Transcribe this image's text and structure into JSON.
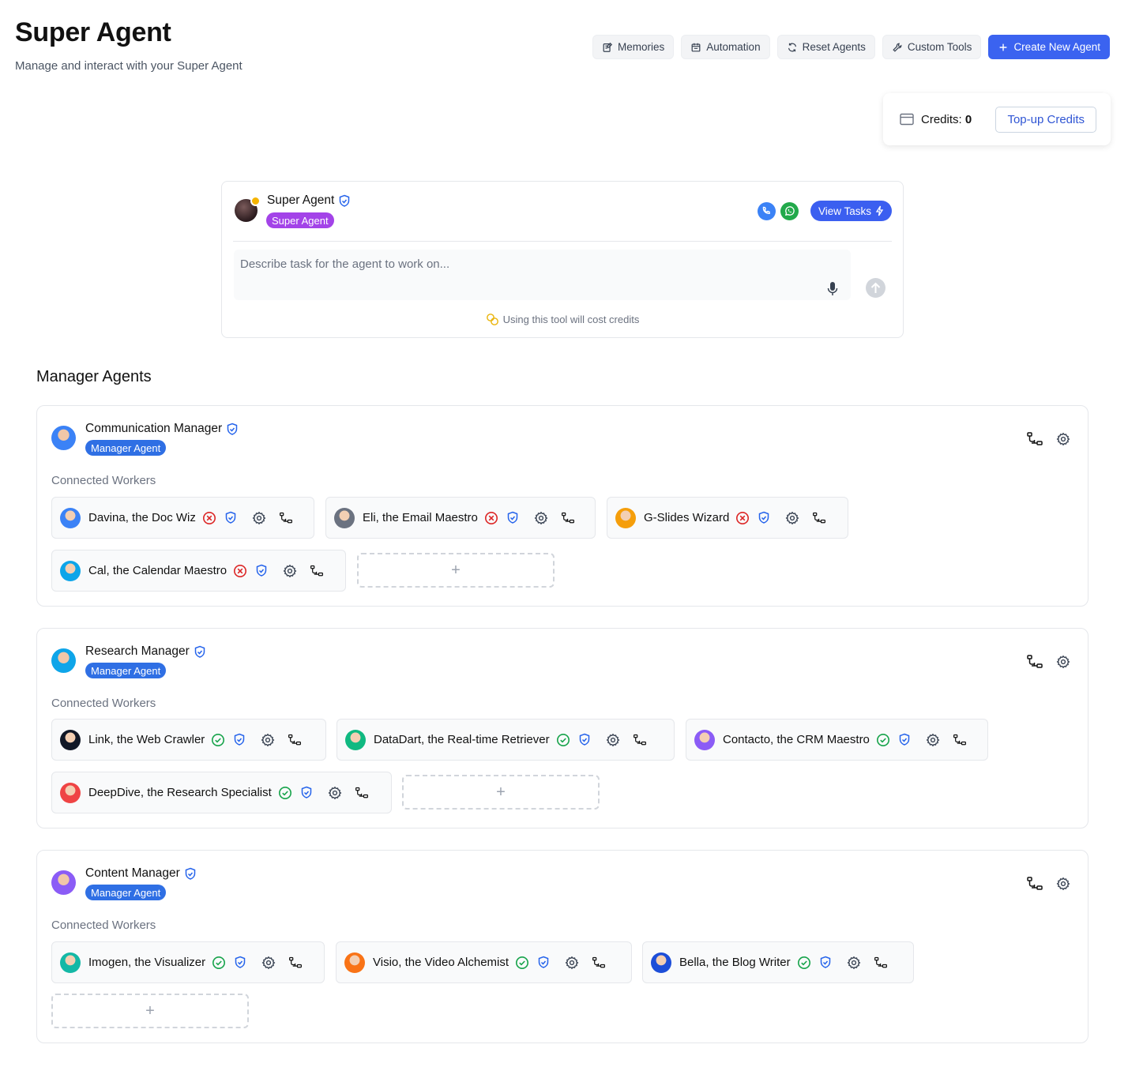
{
  "header": {
    "title": "Super Agent",
    "subtitle": "Manage and interact with your Super Agent"
  },
  "toolbar": {
    "memories": "Memories",
    "automation": "Automation",
    "reset": "Reset Agents",
    "custom_tools": "Custom Tools",
    "create": "Create New Agent"
  },
  "credits": {
    "label": "Credits:",
    "value": "0",
    "topup": "Top-up Credits"
  },
  "super_agent": {
    "name": "Super Agent",
    "badge": "Super Agent",
    "view_tasks": "View Tasks",
    "input_placeholder": "Describe task for the agent to work on...",
    "cost_note": "Using this tool will cost credits"
  },
  "managers_section": {
    "title": "Manager Agents",
    "connected_label": "Connected Workers",
    "badge": "Manager Agent",
    "add": "+"
  },
  "managers": [
    {
      "name": "Communication Manager",
      "workers": [
        {
          "name": "Davina, the Doc Wiz",
          "status": "inactive"
        },
        {
          "name": "Eli, the Email Maestro",
          "status": "inactive"
        },
        {
          "name": "G-Slides Wizard",
          "status": "inactive"
        },
        {
          "name": "Cal, the Calendar Maestro",
          "status": "inactive"
        }
      ]
    },
    {
      "name": "Research Manager",
      "workers": [
        {
          "name": "Link, the Web Crawler",
          "status": "active"
        },
        {
          "name": "DataDart, the Real-time Retriever",
          "status": "active"
        },
        {
          "name": "Contacto, the CRM Maestro",
          "status": "active"
        },
        {
          "name": "DeepDive, the Research Specialist",
          "status": "active"
        }
      ]
    },
    {
      "name": "Content Manager",
      "workers": [
        {
          "name": "Imogen, the Visualizer",
          "status": "active"
        },
        {
          "name": "Visio, the Video Alchemist",
          "status": "active"
        },
        {
          "name": "Bella, the Blog Writer",
          "status": "active"
        }
      ]
    }
  ],
  "colors": {
    "primary": "#3b63f0",
    "super_badge": "#a343e8",
    "manager_badge": "#2f6fe4",
    "active_status": "#16a34a",
    "inactive_status": "#dc2626",
    "shield": "#2563eb"
  },
  "icons": {
    "status_active": "check-circle-icon",
    "status_inactive": "x-circle-icon",
    "verified": "shield-check-icon",
    "settings": "gear-icon",
    "workflow": "workflow-icon"
  }
}
